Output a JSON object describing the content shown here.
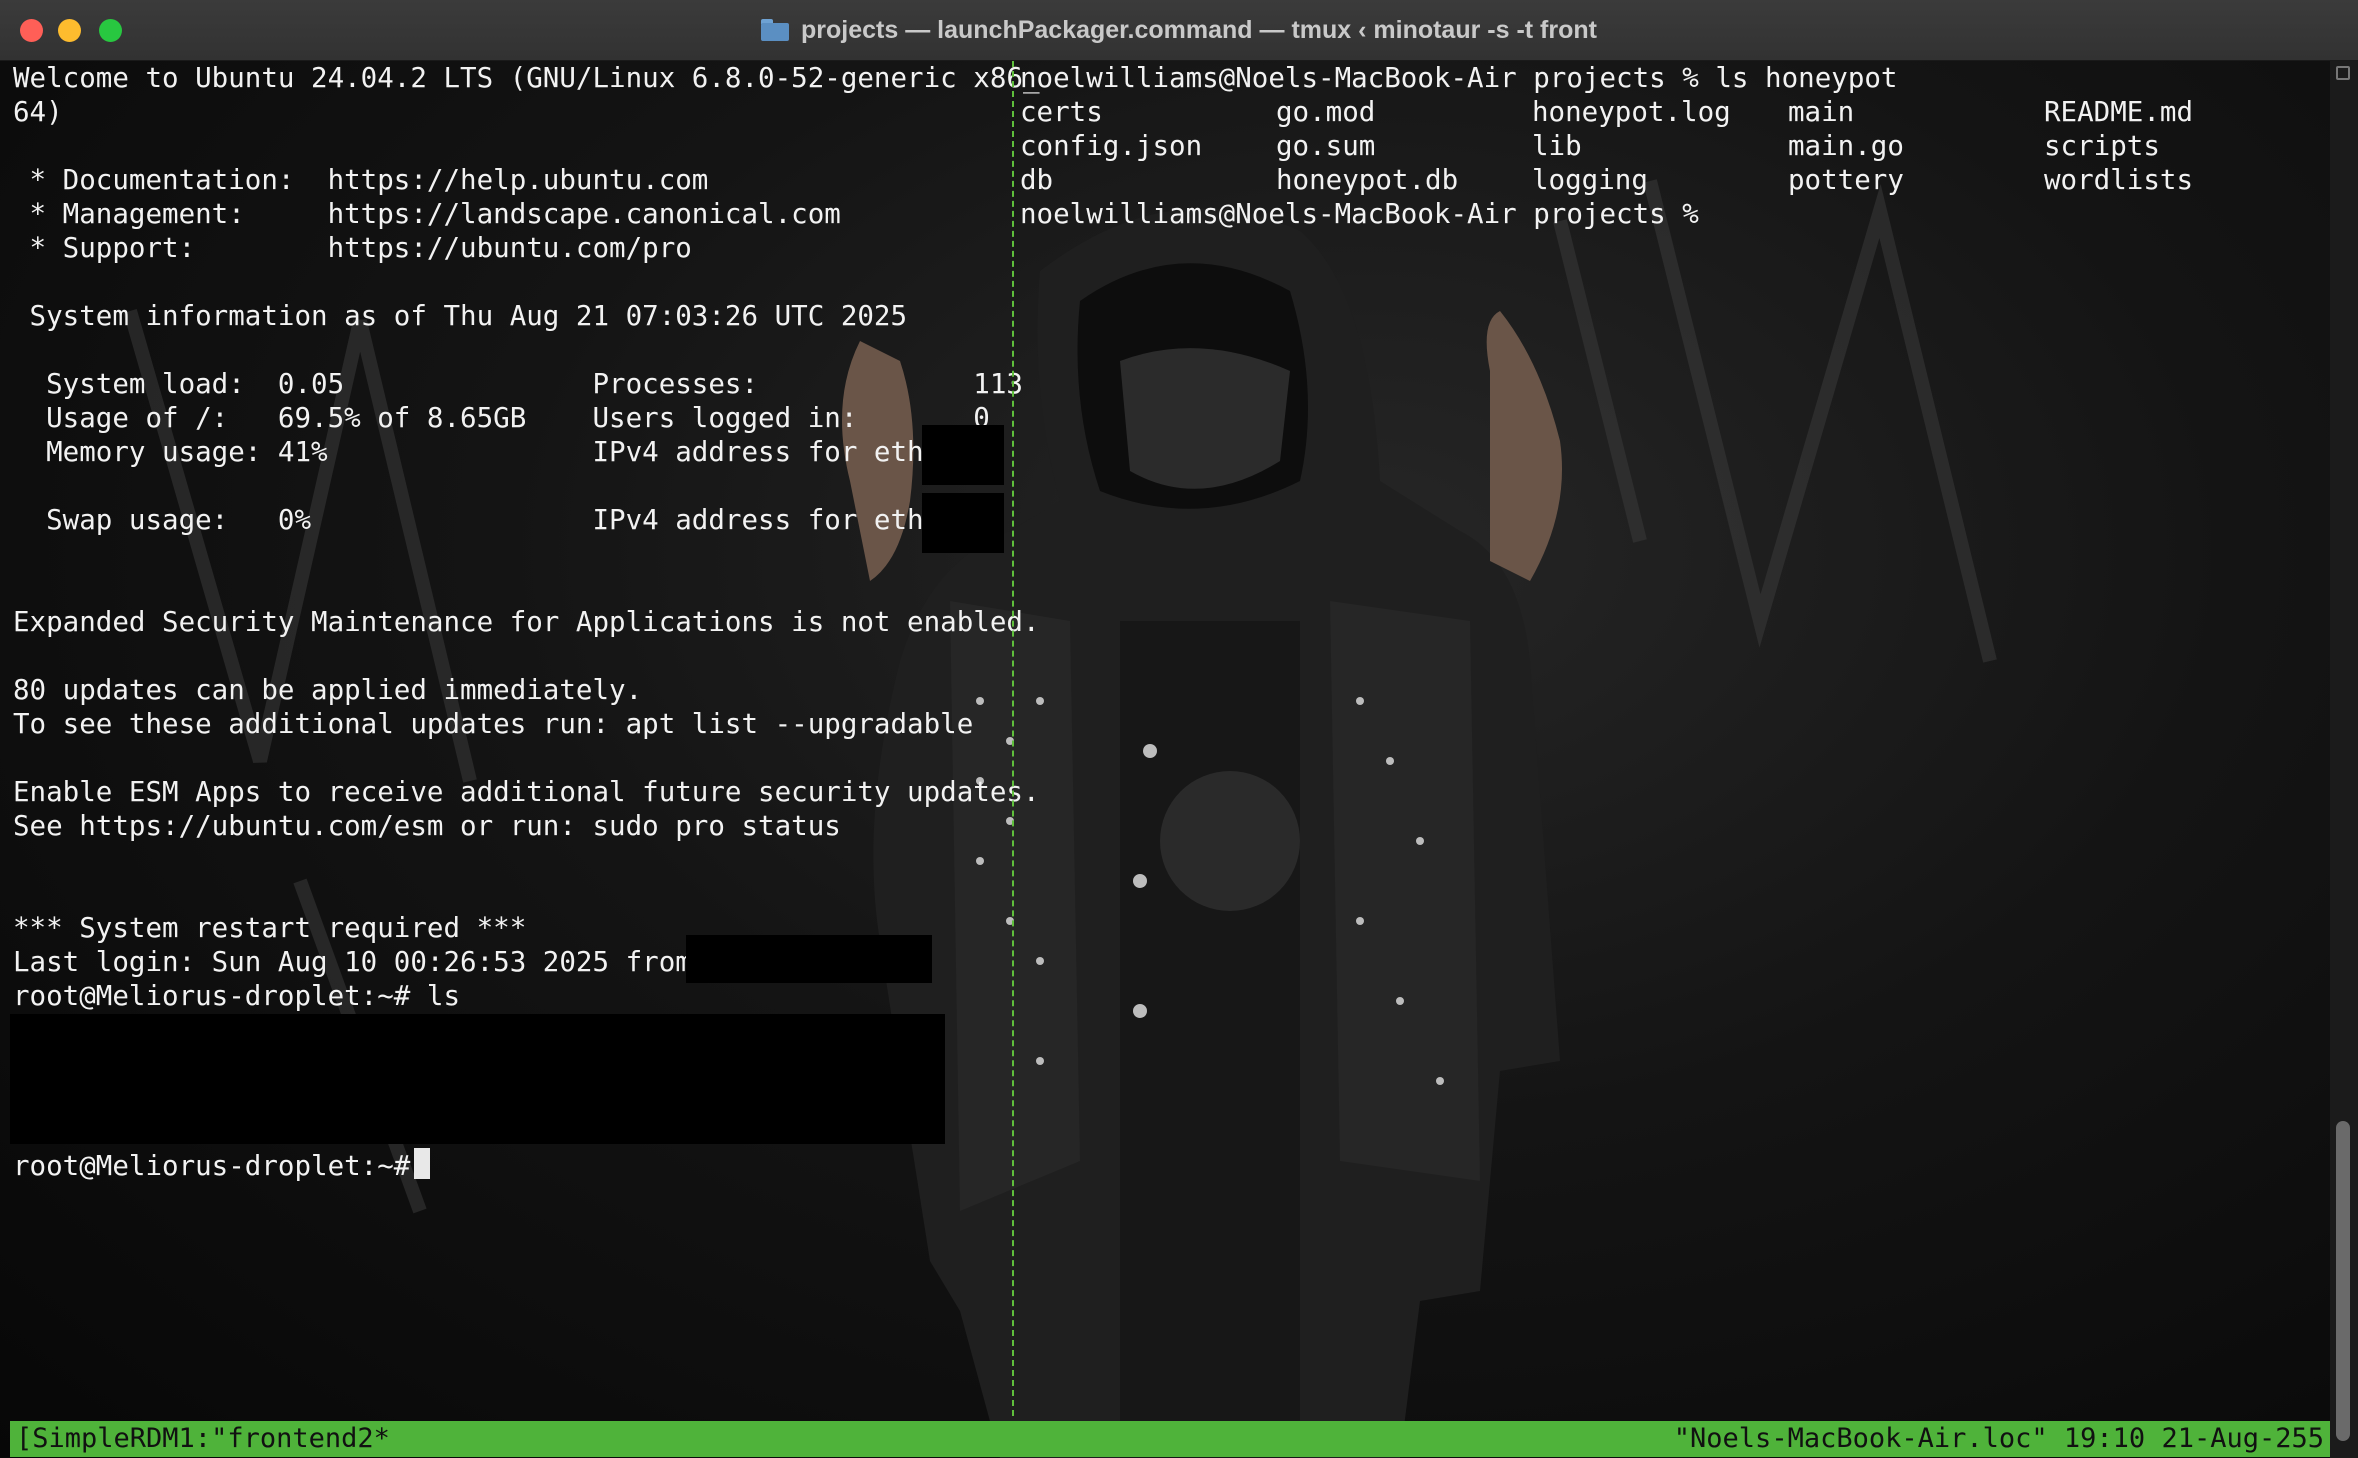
{
  "window": {
    "title": "projects — launchPackager.command — tmux ‹ minotaur -s -t front",
    "folder_icon": "folder-icon"
  },
  "left_pane": {
    "lines": [
      "Welcome to Ubuntu 24.04.2 LTS (GNU/Linux 6.8.0-52-generic x86_",
      "64)",
      "",
      " * Documentation:  https://help.ubuntu.com",
      " * Management:     https://landscape.canonical.com",
      " * Support:        https://ubuntu.com/pro",
      "",
      " System information as of Thu Aug 21 07:03:26 UTC 2025",
      "",
      "  System load:  0.05               Processes:             113",
      "  Usage of /:   69.5% of 8.65GB    Users logged in:       0",
      "  Memory usage: 41%                IPv4 address for eth0:",
      "",
      "  Swap usage:   0%                 IPv4 address for eth0:",
      "",
      "",
      "Expanded Security Maintenance for Applications is not enabled.",
      "",
      "80 updates can be applied immediately.",
      "To see these additional updates run: apt list --upgradable",
      "",
      "Enable ESM Apps to receive additional future security updates.",
      "See https://ubuntu.com/esm or run: sudo pro status",
      "",
      "",
      "*** System restart required ***",
      "Last login: Sun Aug 10 00:26:53 2025 from",
      "root@Meliorus-droplet:~# ls",
      "",
      "",
      "",
      "",
      "root@Meliorus-droplet:~# "
    ]
  },
  "right_pane": {
    "prompt_line": "noelwilliams@Noels-MacBook-Air projects % ls honeypot",
    "listing_rows": [
      [
        "certs",
        "go.mod",
        "honeypot.log",
        "main",
        "README.md"
      ],
      [
        "config.json",
        "go.sum",
        "lib",
        "main.go",
        "scripts"
      ],
      [
        "db",
        "honeypot.db",
        "logging",
        "pottery",
        "wordlists"
      ]
    ],
    "final_prompt": "noelwilliams@Noels-MacBook-Air projects %"
  },
  "status_bar": {
    "left": "[SimpleRDM1:\"frontend2*",
    "right": "\"Noels-MacBook-Air.loc\" 19:10 21-Aug-255"
  },
  "colors": {
    "status_bg": "#4fb33a",
    "divider": "#5fbf3c",
    "text": "#f2f2f2"
  }
}
